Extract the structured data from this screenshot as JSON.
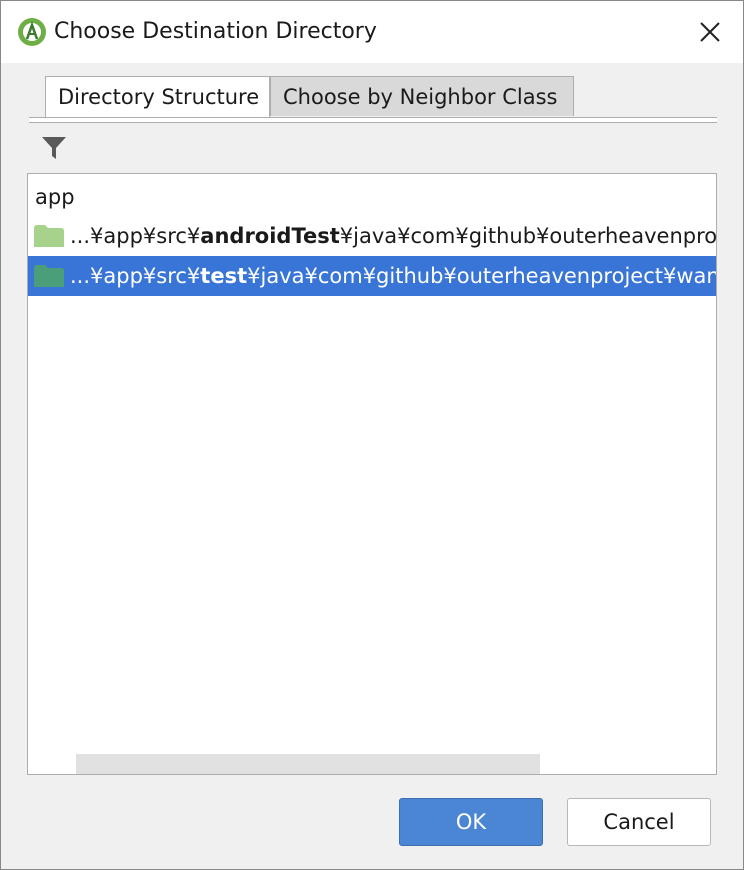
{
  "window": {
    "title": "Choose Destination Directory"
  },
  "tabs": [
    {
      "label": "Directory Structure",
      "active": true
    },
    {
      "label": "Choose by Neighbor Class",
      "active": false
    }
  ],
  "toolbar": {
    "filter_icon": "filter-icon"
  },
  "tree": {
    "root_label": "app",
    "items": [
      {
        "prefix": "...¥app¥src¥",
        "bold": "androidTest",
        "suffix": "¥java¥com¥github¥outerheavenproject¥wanstagram",
        "folder_color": "#a7d28b",
        "selected": false
      },
      {
        "prefix": "...¥app¥src¥",
        "bold": "test",
        "suffix": "¥java¥com¥github¥outerheavenproject¥wanstagram",
        "folder_color": "#4a9e7a",
        "selected": true
      }
    ]
  },
  "buttons": {
    "ok": "OK",
    "cancel": "Cancel"
  },
  "colors": {
    "selection": "#3875d7",
    "ok_button": "#4a86d3"
  }
}
